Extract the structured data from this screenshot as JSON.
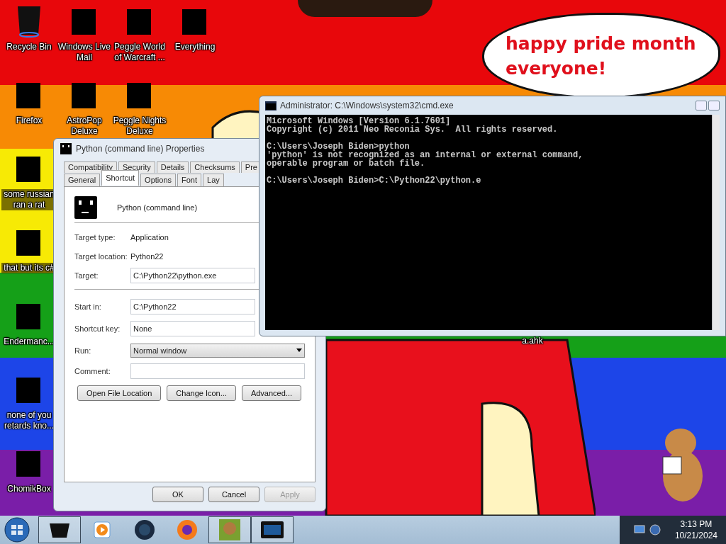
{
  "desktop": {
    "icons": [
      {
        "label": "Recycle Bin",
        "kind": "bin"
      },
      {
        "label": "Windows Live Mail",
        "kind": "redacted"
      },
      {
        "label": "Peggle World of Warcraft ...",
        "kind": "redacted"
      },
      {
        "label": "Everything",
        "kind": "redacted"
      },
      {
        "label": "Firefox",
        "kind": "redacted"
      },
      {
        "label": "AstroPop Deluxe",
        "kind": "redacted"
      },
      {
        "label": "Peggle Nights Deluxe",
        "kind": "redacted"
      },
      {
        "label": "some russian ran a rat",
        "kind": "redacted"
      },
      {
        "label": "that but its c#",
        "kind": "redacted"
      },
      {
        "label": "Endermanc...",
        "kind": "redacted"
      },
      {
        "label": "none of you retards kno...",
        "kind": "redacted"
      },
      {
        "label": "ChomikBox",
        "kind": "redacted"
      }
    ],
    "partly_hidden_icon": {
      "label": "a.ahk"
    },
    "wallpaper_caption": "happy pride month everyone!"
  },
  "properties_dialog": {
    "title": "Python (command line) Properties",
    "tab_rows": [
      [
        {
          "label": "Compatibility",
          "selected": false
        },
        {
          "label": "Security",
          "selected": false
        },
        {
          "label": "Details",
          "selected": false
        },
        {
          "label": "Checksums",
          "selected": false
        },
        {
          "label": "Pre",
          "selected": false
        }
      ],
      [
        {
          "label": "General",
          "selected": false
        },
        {
          "label": "Shortcut",
          "selected": true
        },
        {
          "label": "Options",
          "selected": false
        },
        {
          "label": "Font",
          "selected": false
        },
        {
          "label": "Lay",
          "selected": false
        }
      ]
    ],
    "shortcut_name": "Python (command line)",
    "info": [
      {
        "label": "Target type:",
        "value": "Application"
      },
      {
        "label": "Target location:",
        "value": "Python22"
      }
    ],
    "target": {
      "label": "Target:",
      "value": "C:\\Python22\\python.exe"
    },
    "fields": [
      {
        "label": "Start in:",
        "value": "C:\\Python22"
      },
      {
        "label": "Shortcut key:",
        "value": "None"
      }
    ],
    "run": {
      "label": "Run:",
      "value": "Normal window"
    },
    "comment": {
      "label": "Comment:"
    },
    "action_buttons": [
      "Open File Location",
      "Change Icon...",
      "Advanced..."
    ],
    "dialog_buttons": [
      {
        "label": "OK",
        "disabled": false
      },
      {
        "label": "Cancel",
        "disabled": false
      },
      {
        "label": "Apply",
        "disabled": true
      }
    ]
  },
  "console_window": {
    "title": "Administrator: C:\\Windows\\system32\\cmd.exe",
    "blocks": [
      [
        "Microsoft Windows [Version 6.1.7601]",
        "Copyright (c) 2011 Neo Reconia Sys.  All rights reserved."
      ],
      [
        "C:\\Users\\Joseph Biden>python",
        "'python' is not recognized as an internal or external command,",
        "operable program or batch file."
      ],
      [
        "C:\\Users\\Joseph Biden>C:\\Python22\\python.e"
      ]
    ]
  },
  "taskbar": {
    "clock": {
      "time": "3:13 PM",
      "date": "10/21/2024"
    }
  }
}
